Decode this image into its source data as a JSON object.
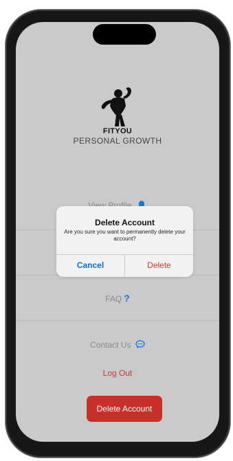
{
  "app": {
    "brand": "FITYOU",
    "tagline": "PERSONAL GROWTH"
  },
  "menu": {
    "view_profile": "View Profile",
    "faq": "FAQ",
    "faq_icon": "?",
    "contact_us": "Contact Us",
    "log_out": "Log Out",
    "delete_account": "Delete Account"
  },
  "alert": {
    "title": "Delete Account",
    "message": "Are you sure you want to permanently delete your account?",
    "cancel": "Cancel",
    "confirm": "Delete"
  },
  "colors": {
    "link_blue": "#1a73e8",
    "destructive_red": "#c8302b",
    "screen_bg": "#cacaca"
  }
}
